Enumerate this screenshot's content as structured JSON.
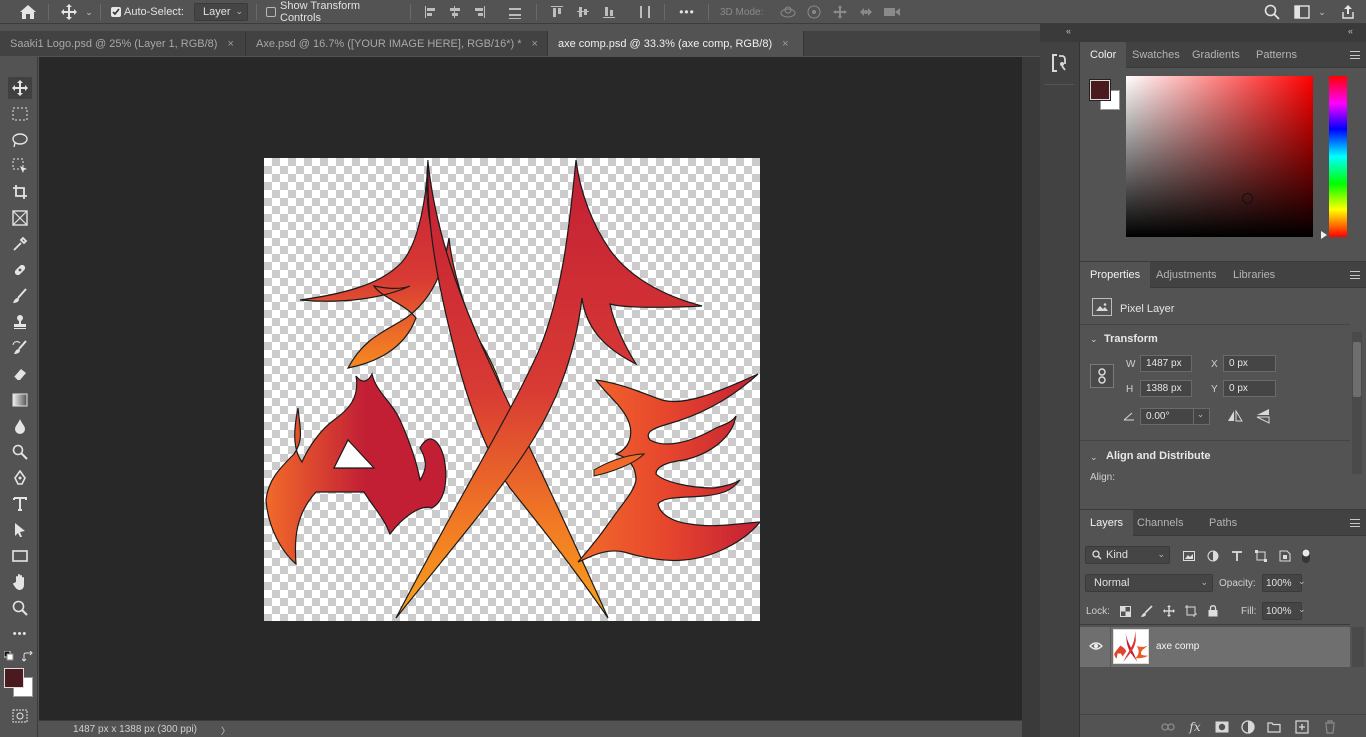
{
  "optionsBar": {
    "auto_select_label": "Auto-Select:",
    "auto_select_target": "Layer",
    "show_transform_label": "Show Transform Controls",
    "mode3d_label": "3D Mode:",
    "more_label": "•••"
  },
  "tabs": [
    {
      "label": "Saaki1 Logo.psd @ 25% (Layer 1, RGB/8)",
      "close": "×"
    },
    {
      "label": "Axe.psd @ 16.7% ([YOUR IMAGE HERE], RGB/16*) *",
      "close": "×"
    },
    {
      "label": "axe comp.psd @ 33.3% (axe comp, RGB/8)",
      "close": "×"
    }
  ],
  "status": {
    "doc_info": "1487 px x 1388 px (300 ppi)",
    "arrow": "〉"
  },
  "colorPanel": {
    "tabs": [
      "Color",
      "Swatches",
      "Gradients",
      "Patterns"
    ],
    "foreground": "#4a1a1f",
    "background": "#ffffff",
    "hue": "#ff0000"
  },
  "propertiesPanel": {
    "tabs": [
      "Properties",
      "Adjustments",
      "Libraries"
    ],
    "layer_type": "Pixel Layer",
    "transform_title": "Transform",
    "w_label": "W",
    "w_value": "1487 px",
    "h_label": "H",
    "h_value": "1388 px",
    "x_label": "X",
    "x_value": "0 px",
    "y_label": "Y",
    "y_value": "0 px",
    "angle_value": "0.00°",
    "align_title": "Align and Distribute",
    "align_label": "Align:"
  },
  "layersPanel": {
    "tabs": [
      "Layers",
      "Channels",
      "Paths"
    ],
    "filter_kind": "Kind",
    "blend_mode": "Normal",
    "opacity_label": "Opacity:",
    "opacity_value": "100%",
    "lock_label": "Lock:",
    "fill_label": "Fill:",
    "fill_value": "100%",
    "layers": [
      {
        "name": "axe comp",
        "visible": true,
        "selected": true
      }
    ]
  },
  "colors": {
    "artwork_dark": "#c21f35",
    "artwork_orange": "#f26a2a",
    "artwork_yellow": "#f7a21b",
    "canvas_bg": "#282828",
    "ui_bg": "#535353"
  }
}
